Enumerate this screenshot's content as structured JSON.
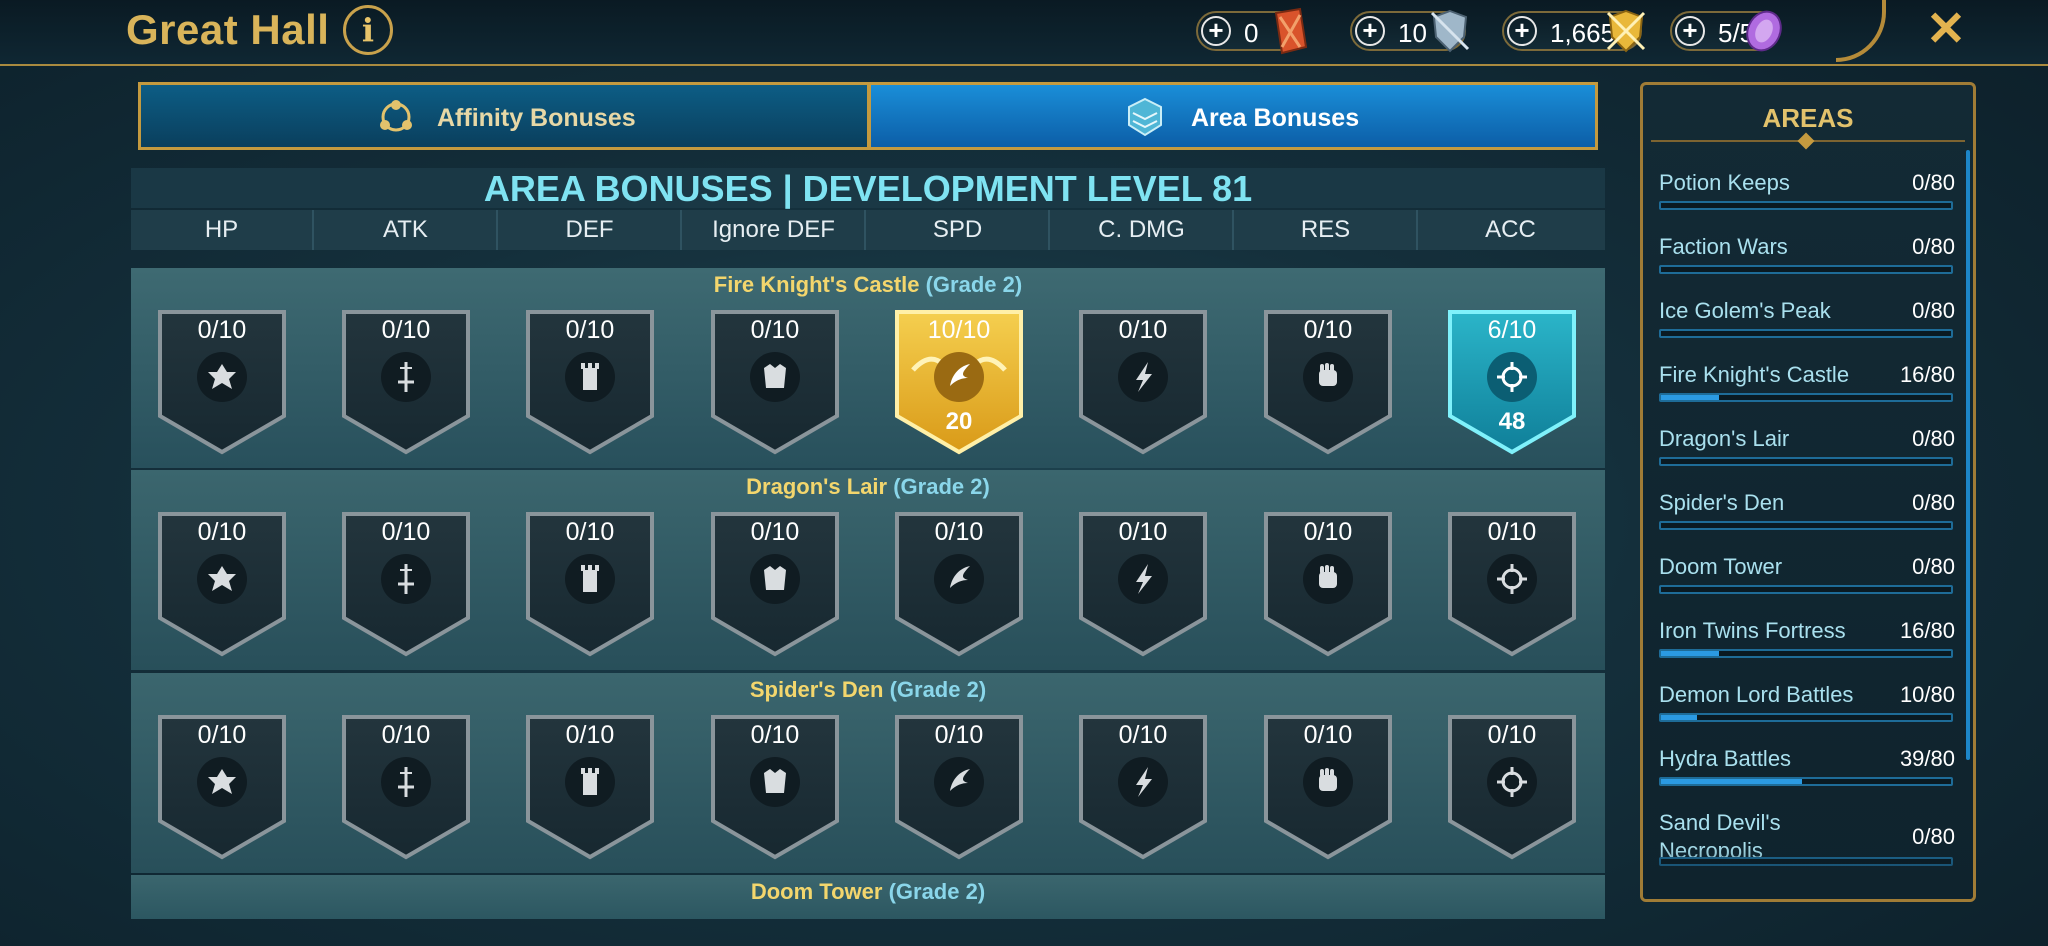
{
  "header": {
    "title": "Great Hall",
    "info_icon": "info-icon",
    "close_icon": "close-icon",
    "resources": [
      {
        "value": "0",
        "icon": "red-scroll-icon",
        "color": "#d9532b"
      },
      {
        "value": "10",
        "icon": "silver-shield-icon",
        "color": "#9fb7c9"
      },
      {
        "value": "1,665",
        "icon": "gold-shield-icon",
        "color": "#e9b83a"
      },
      {
        "value": "5/5",
        "icon": "purple-gem-icon",
        "color": "#b06be0"
      }
    ]
  },
  "tabs": [
    {
      "label": "Affinity Bonuses",
      "icon": "affinity-icon",
      "active": false
    },
    {
      "label": "Area Bonuses",
      "icon": "area-icon",
      "active": true
    }
  ],
  "main": {
    "title": "AREA BONUSES | DEVELOPMENT LEVEL 81",
    "columns": [
      "HP",
      "ATK",
      "DEF",
      "Ignore DEF",
      "SPD",
      "C. DMG",
      "RES",
      "ACC"
    ],
    "rows": [
      {
        "name": "Fire Knight's Castle",
        "grade": "(Grade 2)",
        "cells": [
          {
            "level": "0/10",
            "icon": "hp-icon",
            "state": "empty",
            "bonus": ""
          },
          {
            "level": "0/10",
            "icon": "atk-sword-icon",
            "state": "empty",
            "bonus": ""
          },
          {
            "level": "0/10",
            "icon": "def-tower-icon",
            "state": "empty",
            "bonus": ""
          },
          {
            "level": "0/10",
            "icon": "ignore-def-armor-icon",
            "state": "empty",
            "bonus": ""
          },
          {
            "level": "10/10",
            "icon": "spd-wing-icon",
            "state": "max",
            "bonus": "20"
          },
          {
            "level": "0/10",
            "icon": "crit-dmg-icon",
            "state": "empty",
            "bonus": ""
          },
          {
            "level": "0/10",
            "icon": "res-fist-icon",
            "state": "empty",
            "bonus": ""
          },
          {
            "level": "6/10",
            "icon": "acc-target-icon",
            "state": "partial",
            "bonus": "48"
          }
        ]
      },
      {
        "name": "Dragon's Lair",
        "grade": "(Grade 2)",
        "cells": [
          {
            "level": "0/10",
            "icon": "hp-icon",
            "state": "empty",
            "bonus": ""
          },
          {
            "level": "0/10",
            "icon": "atk-sword-icon",
            "state": "empty",
            "bonus": ""
          },
          {
            "level": "0/10",
            "icon": "def-tower-icon",
            "state": "empty",
            "bonus": ""
          },
          {
            "level": "0/10",
            "icon": "ignore-def-armor-icon",
            "state": "empty",
            "bonus": ""
          },
          {
            "level": "0/10",
            "icon": "spd-wing-icon",
            "state": "empty",
            "bonus": ""
          },
          {
            "level": "0/10",
            "icon": "crit-dmg-icon",
            "state": "empty",
            "bonus": ""
          },
          {
            "level": "0/10",
            "icon": "res-fist-icon",
            "state": "empty",
            "bonus": ""
          },
          {
            "level": "0/10",
            "icon": "acc-target-icon",
            "state": "empty",
            "bonus": ""
          }
        ]
      },
      {
        "name": "Spider's Den",
        "grade": "(Grade 2)",
        "cells": [
          {
            "level": "0/10",
            "icon": "hp-icon",
            "state": "empty",
            "bonus": ""
          },
          {
            "level": "0/10",
            "icon": "atk-sword-icon",
            "state": "empty",
            "bonus": ""
          },
          {
            "level": "0/10",
            "icon": "def-tower-icon",
            "state": "empty",
            "bonus": ""
          },
          {
            "level": "0/10",
            "icon": "ignore-def-armor-icon",
            "state": "empty",
            "bonus": ""
          },
          {
            "level": "0/10",
            "icon": "spd-wing-icon",
            "state": "empty",
            "bonus": ""
          },
          {
            "level": "0/10",
            "icon": "crit-dmg-icon",
            "state": "empty",
            "bonus": ""
          },
          {
            "level": "0/10",
            "icon": "res-fist-icon",
            "state": "empty",
            "bonus": ""
          },
          {
            "level": "0/10",
            "icon": "acc-target-icon",
            "state": "empty",
            "bonus": ""
          }
        ]
      }
    ],
    "next_row": {
      "name": "Doom Tower",
      "grade": "(Grade 2)"
    }
  },
  "sidebar": {
    "title": "AREAS",
    "items": [
      {
        "name": "Potion Keeps",
        "count": "0/80",
        "progress": 0.0
      },
      {
        "name": "Faction Wars",
        "count": "0/80",
        "progress": 0.0
      },
      {
        "name": "Ice Golem's Peak",
        "count": "0/80",
        "progress": 0.0
      },
      {
        "name": "Fire Knight's Castle",
        "count": "16/80",
        "progress": 0.2
      },
      {
        "name": "Dragon's Lair",
        "count": "0/80",
        "progress": 0.0
      },
      {
        "name": "Spider's Den",
        "count": "0/80",
        "progress": 0.0
      },
      {
        "name": "Doom Tower",
        "count": "0/80",
        "progress": 0.0
      },
      {
        "name": "Iron Twins Fortress",
        "count": "16/80",
        "progress": 0.2
      },
      {
        "name": "Demon Lord Battles",
        "count": "10/80",
        "progress": 0.125
      },
      {
        "name": "Hydra Battles",
        "count": "39/80",
        "progress": 0.4875
      },
      {
        "name": "Sand Devil's Necropolis",
        "count": "0/80",
        "progress": 0.0
      }
    ]
  }
}
